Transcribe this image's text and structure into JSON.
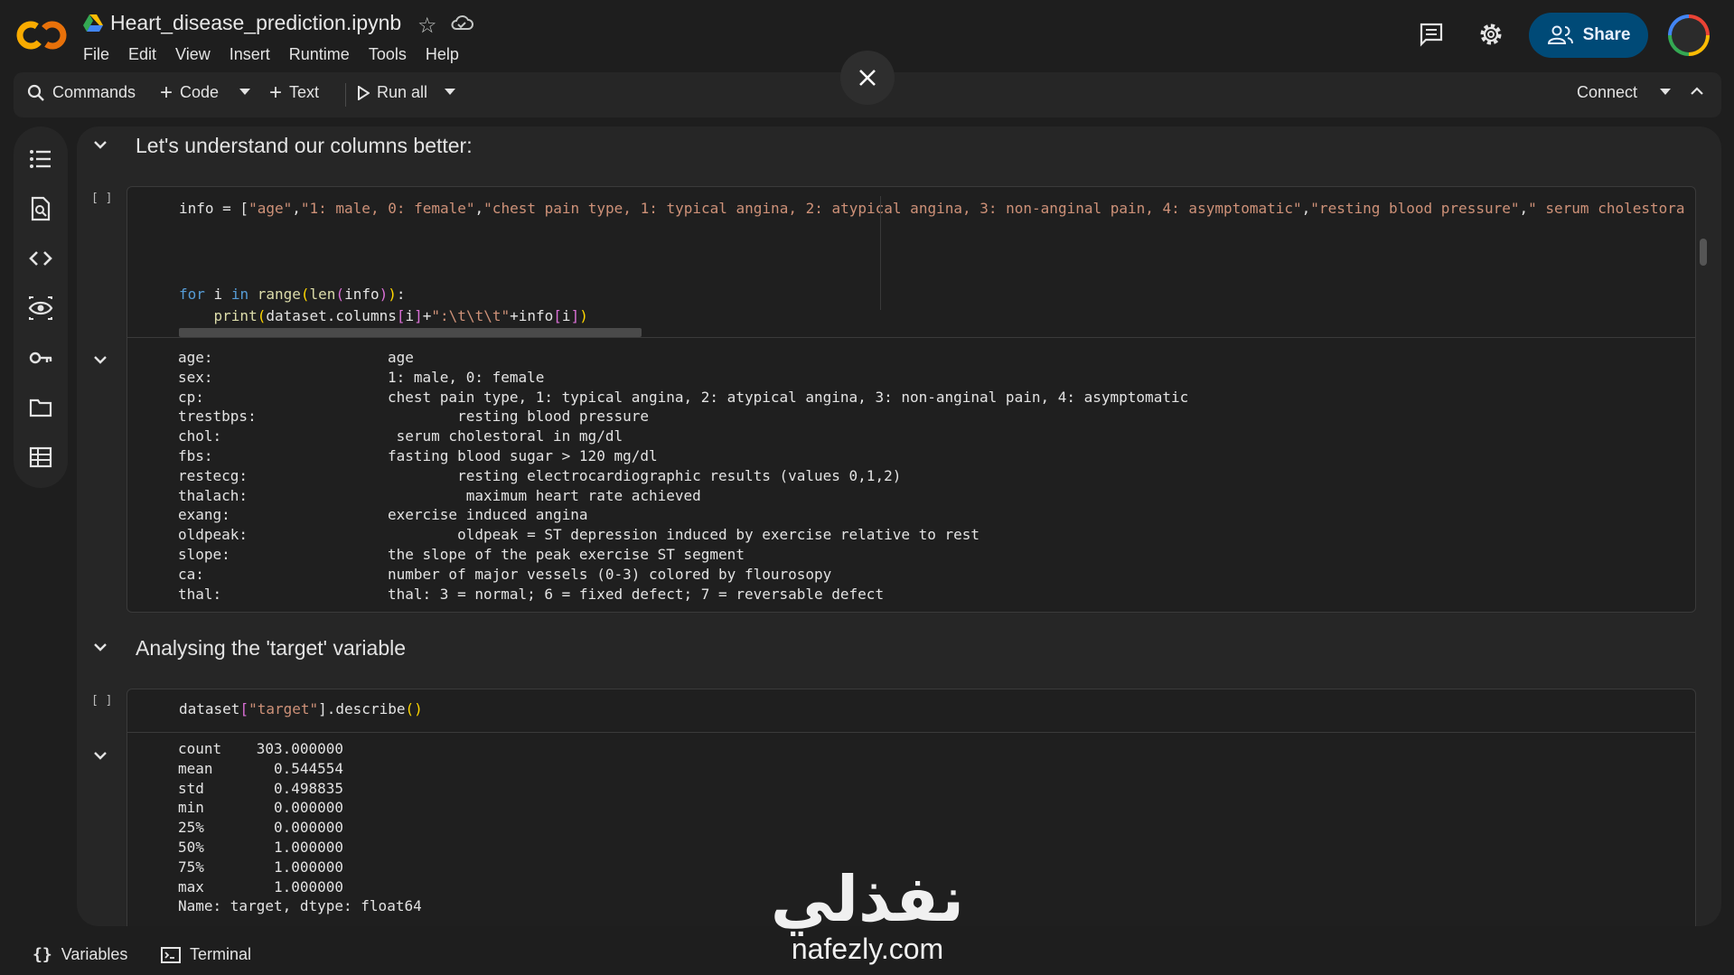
{
  "header": {
    "title": "Heart_disease_prediction.ipynb",
    "menu": [
      "File",
      "Edit",
      "View",
      "Insert",
      "Runtime",
      "Tools",
      "Help"
    ],
    "share_label": "Share",
    "icons": [
      "colab-logo-icon",
      "drive-icon",
      "star-icon",
      "cloud-icon",
      "comment-icon",
      "settings-icon"
    ]
  },
  "toolbar": {
    "commands": "Commands",
    "code": "Code",
    "text": "Text",
    "run_all": "Run all",
    "connect": "Connect"
  },
  "sections": {
    "s1": "Let's understand our columns better:",
    "s2": "Analysing the 'target' variable"
  },
  "cell1": {
    "bracket": "[ ]",
    "line1": {
      "a": "info = [",
      "b": "\"age\"",
      "c": ",",
      "d": "\"1: male, 0: female\"",
      "e": ",",
      "f": "\"chest pain type, 1: typical angina, 2: atypical angina, 3: non-anginal pain, 4: asymptomatic\"",
      "g": ",",
      "h": "\"resting blood pressure\"",
      "i": ",",
      "j": "\" serum cholestora"
    },
    "line2": {
      "a": "for",
      "b": " i ",
      "c": "in",
      "d": " ",
      "e": "range",
      "f": "(",
      "g": "len",
      "h": "(",
      "i": "info",
      "j": ")",
      "k": ")",
      "l": ":"
    },
    "line3": {
      "a": "    ",
      "b": "print",
      "c": "(",
      "d": "dataset.columns",
      "e": "[",
      "f": "i",
      "g": "]",
      "h": "+",
      "i": "\":\\t\\t\\t\"",
      "j": "+info",
      "k": "[",
      "l": "i",
      "m": "]",
      "n": ")"
    }
  },
  "output1": [
    {
      "k": "age:",
      "v": "age"
    },
    {
      "k": "sex:",
      "v": "1: male, 0: female"
    },
    {
      "k": "cp:",
      "v": "chest pain type, 1: typical angina, 2: atypical angina, 3: non-anginal pain, 4: asymptomatic"
    },
    {
      "k": "trestbps:",
      "v": "        resting blood pressure"
    },
    {
      "k": "chol:",
      "v": " serum cholestoral in mg/dl"
    },
    {
      "k": "fbs:",
      "v": "fasting blood sugar > 120 mg/dl"
    },
    {
      "k": "restecg:",
      "v": "        resting electrocardiographic results (values 0,1,2)"
    },
    {
      "k": "thalach:",
      "v": "         maximum heart rate achieved"
    },
    {
      "k": "exang:",
      "v": "exercise induced angina"
    },
    {
      "k": "oldpeak:",
      "v": "        oldpeak = ST depression induced by exercise relative to rest"
    },
    {
      "k": "slope:",
      "v": "the slope of the peak exercise ST segment"
    },
    {
      "k": "ca:",
      "v": "number of major vessels (0-3) colored by flourosopy"
    },
    {
      "k": "thal:",
      "v": "thal: 3 = normal; 6 = fixed defect; 7 = reversable defect"
    }
  ],
  "cell2": {
    "bracket": "[ ]",
    "a": "dataset",
    "b": "[",
    "c": "\"target\"",
    "d": "].describe",
    "e": "()"
  },
  "output2": [
    "count    303.000000",
    "mean       0.544554",
    "std        0.498835",
    "min        0.000000",
    "25%        0.000000",
    "50%        1.000000",
    "75%        1.000000",
    "max        1.000000",
    "Name: target, dtype: float64"
  ],
  "bottom": {
    "variables": "Variables",
    "terminal": "Terminal"
  },
  "watermark": {
    "arabic": "نفذلي",
    "url": "nafezly.com"
  },
  "colors": {
    "accent": "#004a77",
    "string": "#ce9178",
    "keyword": "#569cd6"
  }
}
